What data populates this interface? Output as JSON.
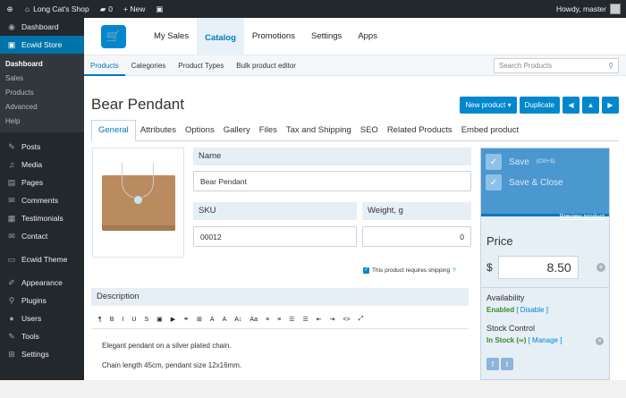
{
  "adminbar": {
    "site_name": "Long Cat's Shop",
    "comments_count": "0",
    "new_label": "+ New",
    "greeting": "Howdy, master"
  },
  "sidebar": {
    "items_top": [
      {
        "label": "Dashboard",
        "icon": "dashboard-icon",
        "glyph": "◉"
      }
    ],
    "active": {
      "label": "Ecwid Store",
      "icon": "ecwid-icon",
      "glyph": "▣"
    },
    "sub": [
      "Dashboard",
      "Sales",
      "Products",
      "Advanced",
      "Help"
    ],
    "items": [
      {
        "label": "Posts",
        "icon": "pin-icon",
        "glyph": "✎"
      },
      {
        "label": "Media",
        "icon": "media-icon",
        "glyph": "♫"
      },
      {
        "label": "Pages",
        "icon": "pages-icon",
        "glyph": "▤"
      },
      {
        "label": "Comments",
        "icon": "comments-icon",
        "glyph": "✉"
      },
      {
        "label": "Testimonials",
        "icon": "testimonials-icon",
        "glyph": "▦"
      },
      {
        "label": "Contact",
        "icon": "contact-icon",
        "glyph": "✉"
      },
      {
        "label": "Ecwid Theme",
        "icon": "theme-icon",
        "glyph": "▭"
      },
      {
        "label": "Appearance",
        "icon": "appearance-icon",
        "glyph": "✐"
      },
      {
        "label": "Plugins",
        "icon": "plugins-icon",
        "glyph": "⚲"
      },
      {
        "label": "Users",
        "icon": "users-icon",
        "glyph": "●"
      },
      {
        "label": "Tools",
        "icon": "tools-icon",
        "glyph": "✎"
      },
      {
        "label": "Settings",
        "icon": "settings-icon",
        "glyph": "⊞"
      }
    ]
  },
  "topnav": [
    "My Sales",
    "Catalog",
    "Promotions",
    "Settings",
    "Apps"
  ],
  "subnav": [
    "Products",
    "Categories",
    "Product Types",
    "Bulk product editor"
  ],
  "search": {
    "placeholder": "Search Products"
  },
  "product": {
    "title": "Bear Pendant"
  },
  "actions": {
    "new_product": "New product ▾",
    "duplicate": "Duplicate"
  },
  "tabs": [
    "General",
    "Attributes",
    "Options",
    "Gallery",
    "Files",
    "Tax and Shipping",
    "SEO",
    "Related Products",
    "Embed product"
  ],
  "form": {
    "name_label": "Name",
    "name_value": "Bear Pendant",
    "sku_label": "SKU",
    "sku_value": "00012",
    "weight_label": "Weight, g",
    "weight_value": "0",
    "shipping_label": "This product requires shipping",
    "description_label": "Description",
    "description_lines": [
      "Elegant pendant on a silver plated chain.",
      "Chain length 45cm, pendant size 12x16mm."
    ]
  },
  "toolbar": [
    "¶",
    "B",
    "I",
    "U",
    "S",
    "▣",
    "▶",
    "⚭",
    "⊞",
    "A",
    "A",
    "A↕",
    "Aa",
    "≡",
    "≡",
    "☰",
    "☰",
    "⇤",
    "⇥",
    "<>",
    "⤢"
  ],
  "panel": {
    "save": "Save",
    "save_hint": "(Ctrl+S)",
    "save_close": "Save & Close",
    "preview": "Preview product",
    "price_label": "Price",
    "currency": "$",
    "price": "8.50",
    "availability_label": "Availability",
    "availability_status": "Enabled",
    "availability_link": "[ Disable ]",
    "stock_label": "Stock Control",
    "stock_status": "In Stock (∞)",
    "stock_link": "[ Manage ]"
  },
  "colors": {
    "accent": "#0087cd",
    "sidebar": "#23282d",
    "active_menu": "#0073aa",
    "panel": "#e6eef6"
  }
}
